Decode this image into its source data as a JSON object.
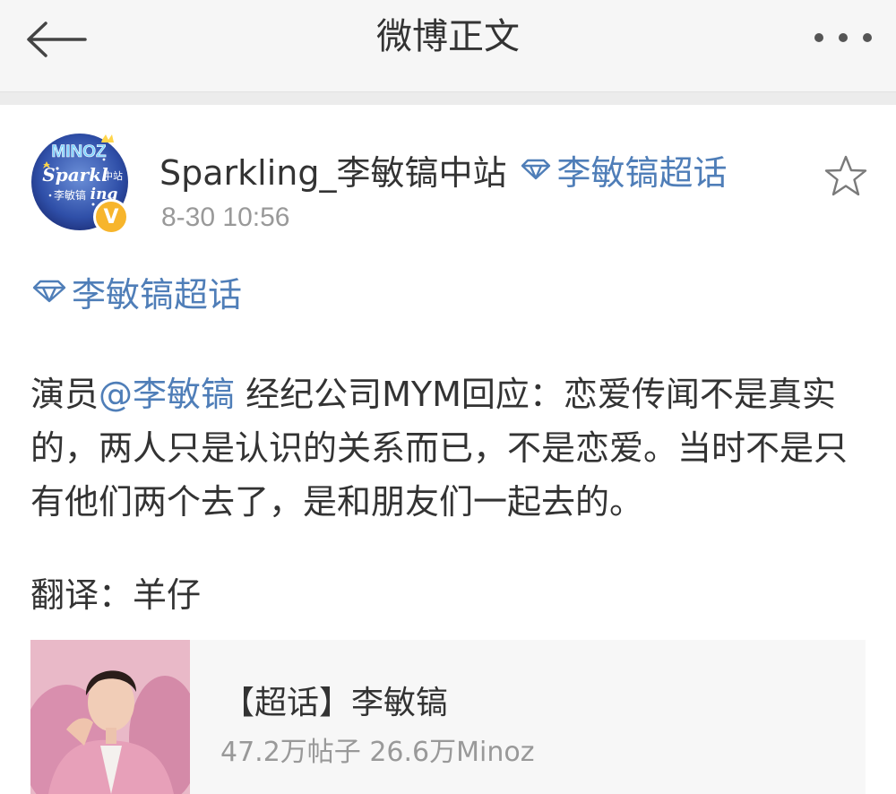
{
  "nav": {
    "title": "微博正文",
    "back_icon": "arrow-left-icon",
    "more_icon": "ellipsis-icon"
  },
  "post": {
    "author_name": "Sparkling_李敏镐中站",
    "author_topic": "李敏镐超话",
    "time": "8-30 10:56",
    "verified_icon": "verified-badge-icon",
    "verified_glyph": "V",
    "avatar_text": {
      "arc": "MINOZ",
      "script_top": "Sparkl",
      "script_bottom": "ing",
      "station": "中站",
      "name": "李敏镐"
    },
    "topic_link": "李敏镐超话",
    "body": {
      "prefix": "演员",
      "mention": "@李敏镐",
      "text": " 经纪公司MYM回应：恋爱传闻不是真实的，两人只是认识的关系而已，不是恋爱。当时不是只有他们两个去了，是和朋友们一起去的。"
    },
    "translator": "翻译：羊仔"
  },
  "card": {
    "title": "【超话】李敏镐",
    "subtitle": "47.2万帖子 26.6万Minoz"
  },
  "colors": {
    "link": "#4f7eb8",
    "text": "#333333",
    "muted": "#999999",
    "badge": "#f7b52c",
    "nav_bg": "#f6f6f6",
    "card_bg": "#f7f7f7"
  }
}
